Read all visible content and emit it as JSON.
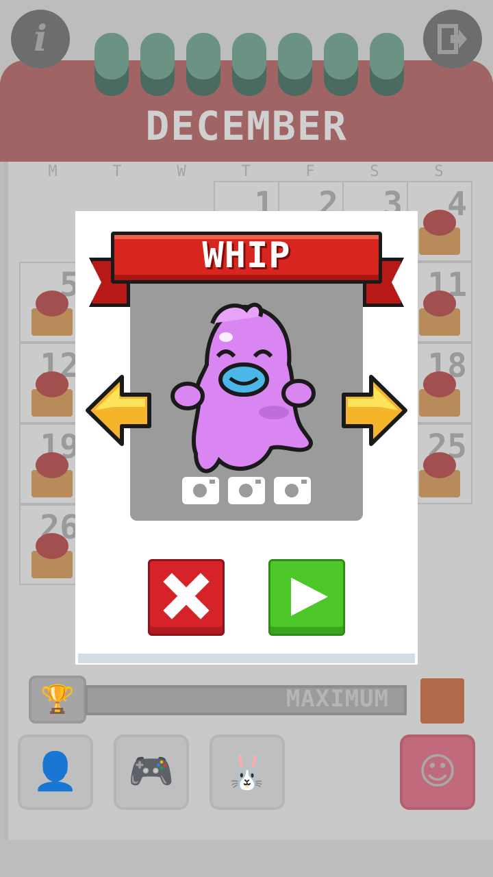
{
  "calendar": {
    "month": "DECEMBER",
    "weekdays": [
      "M",
      "T",
      "W",
      "T",
      "F",
      "S",
      "S"
    ],
    "days_visible": [
      "1",
      "2",
      "3",
      "4",
      "5",
      "11",
      "12",
      "18",
      "19",
      "25",
      "26"
    ]
  },
  "top": {
    "info_label": "i"
  },
  "progress": {
    "label": "MAXIMUM"
  },
  "modal": {
    "title": "WHIP",
    "photos_count": 3
  },
  "colors": {
    "banner_red": "#d8251f",
    "close_red": "#d6232a",
    "play_green": "#4ec72a",
    "character_pink": "#d986f2",
    "pacifier_blue": "#4bb6e8",
    "arrow_yellow": "#f6b42a"
  }
}
